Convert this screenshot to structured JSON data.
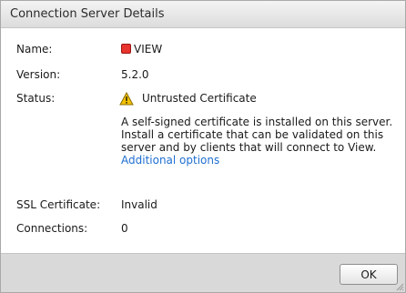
{
  "dialog": {
    "title": "Connection Server Details"
  },
  "fields": {
    "name_label": "Name:",
    "name_value": "VIEW",
    "name_icon": "server-status-icon",
    "name_icon_color": "#e8332f",
    "version_label": "Version:",
    "version_value": "5.2.0",
    "status_label": "Status:",
    "status_icon": "warning-icon",
    "status_value": "Untrusted Certificate",
    "description": "A self-signed certificate is installed on this server. Install a certificate that can be validated on this server and by clients that will connect to View.",
    "link_text": "Additional options",
    "ssl_label": "SSL Certificate:",
    "ssl_value": "Invalid",
    "connections_label": "Connections:",
    "connections_value": "0"
  },
  "footer": {
    "ok_label": "OK"
  },
  "colors": {
    "link": "#1f6fd1",
    "warning": "#f2c200",
    "footer_bg": "#d9d9d9"
  }
}
